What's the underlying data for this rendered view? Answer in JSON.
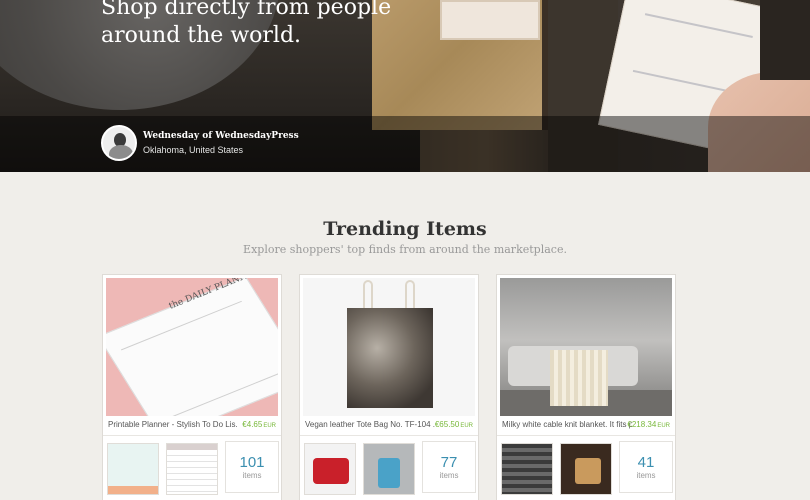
{
  "hero": {
    "headline": "Shop directly from people around the world.",
    "seller_name": "Wednesday of WednesdayPress",
    "seller_location": "Oklahoma, United States"
  },
  "trending": {
    "title": "Trending Items",
    "subtitle": "Explore shoppers' top finds from around the marketplace.",
    "cards": [
      {
        "caption": "Printable Planner - Stylish To Do Lis...",
        "price": "€4.65",
        "currency": "EUR",
        "count": "101",
        "count_label": "items"
      },
      {
        "caption": "Vegan leather Tote Bag No. TF-104 ...",
        "price": "€65.50",
        "currency": "EUR",
        "count": "77",
        "count_label": "items"
      },
      {
        "caption": "Milky white cable knit blanket. It fits p...",
        "price": "€218.34",
        "currency": "EUR",
        "count": "41",
        "count_label": "items"
      }
    ]
  }
}
